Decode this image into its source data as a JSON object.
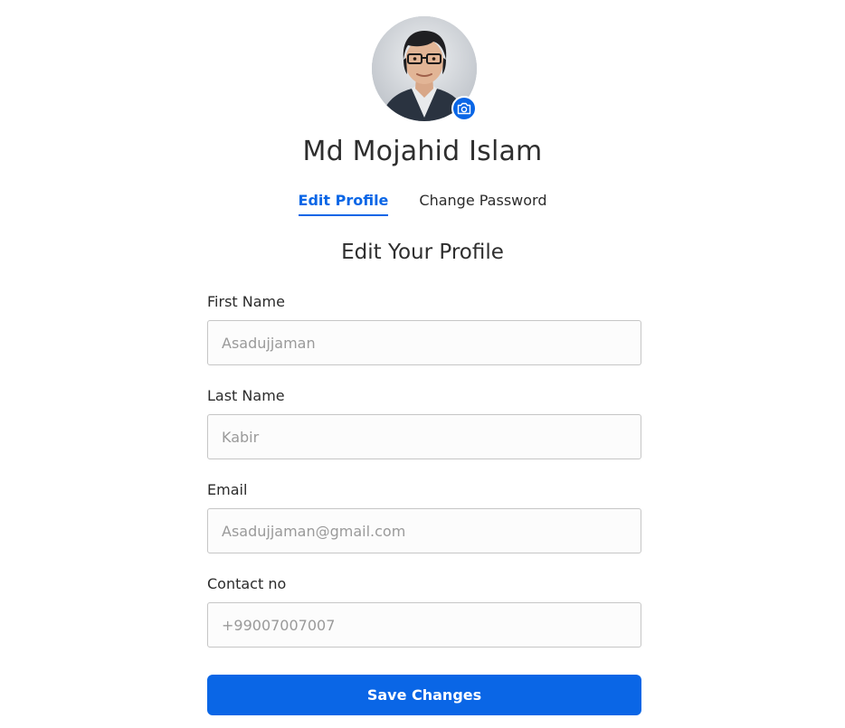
{
  "profile": {
    "name": "Md Mojahid Islam",
    "avatar_icon": "profile-photo",
    "camera_icon": "camera-icon"
  },
  "tabs": [
    {
      "label": "Edit Profile",
      "active": true
    },
    {
      "label": "Change Password",
      "active": false
    }
  ],
  "form": {
    "title": "Edit Your Profile",
    "fields": [
      {
        "label": "First Name",
        "placeholder": "Asadujjaman"
      },
      {
        "label": "Last Name",
        "placeholder": "Kabir"
      },
      {
        "label": "Email",
        "placeholder": "Asadujjaman@gmail.com"
      },
      {
        "label": "Contact no",
        "placeholder": "+99007007007"
      }
    ],
    "submit_label": "Save Changes"
  },
  "colors": {
    "accent": "#0a66e6",
    "text": "#2b2b2b",
    "input_border": "#c6c6c6",
    "placeholder": "#9a9a9a"
  }
}
